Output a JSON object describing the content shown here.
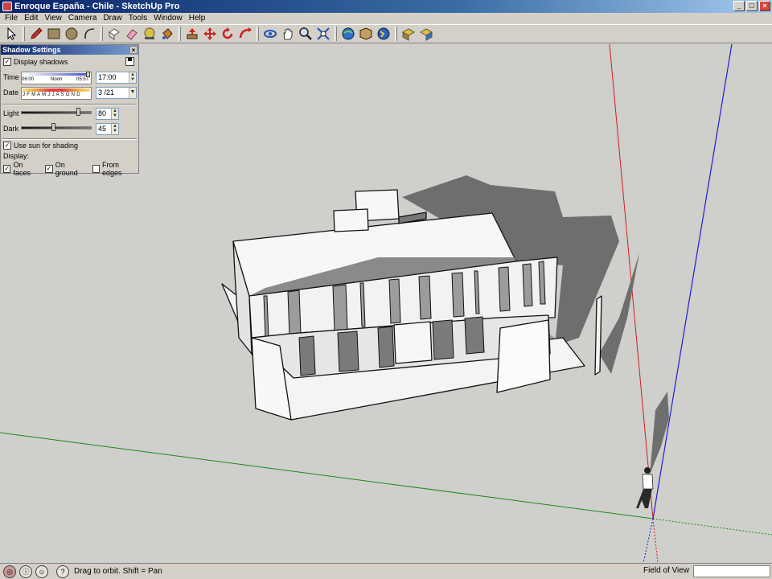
{
  "window": {
    "title": "Enroque España - Chile - SketchUp Pro",
    "controls": [
      "_",
      "□",
      "×"
    ]
  },
  "menu": [
    "File",
    "Edit",
    "View",
    "Camera",
    "Draw",
    "Tools",
    "Window",
    "Help"
  ],
  "toolbar_icons": [
    "select-icon",
    "pencil-icon",
    "rectangle-icon",
    "circle-icon",
    "arc-icon",
    "make-component-icon",
    "eraser-icon",
    "tape-measure-icon",
    "paint-bucket-icon",
    "push-pull-icon",
    "move-icon",
    "rotate-icon",
    "follow-me-icon",
    "orbit-icon",
    "pan-icon",
    "zoom-icon",
    "zoom-extents-icon",
    "get-models-icon",
    "share-model-icon",
    "google-earth-icon",
    "get-photo-texture-icon",
    "share-component-icon"
  ],
  "shadow_panel": {
    "title": "Shadow Settings",
    "display_shadows_label": "Display shadows",
    "display_shadows_checked": true,
    "time_label": "Time",
    "time_start": "06:00",
    "time_noon": "Noon",
    "time_end": "05:57",
    "time_value": "17:00",
    "date_label": "Date",
    "date_months": "J F M A M J J A S O N D",
    "date_value": "3 /21",
    "light_label": "Light",
    "light_value": "80",
    "dark_label": "Dark",
    "dark_value": "45",
    "use_sun_label": "Use sun for shading",
    "use_sun_checked": true,
    "display_label": "Display:",
    "on_faces_label": "On faces",
    "on_faces_checked": true,
    "on_ground_label": "On ground",
    "on_ground_checked": true,
    "from_edges_label": "From edges",
    "from_edges_checked": false
  },
  "status": {
    "hint": "Drag to orbit.  Shift = Pan",
    "measurement_label": "Field of View",
    "measurement_value": ""
  },
  "colors": {
    "red_axis": "#d02020",
    "green_axis": "#1a8a1a",
    "blue_axis": "#1e1ee0",
    "sky_ground": "#cfcfcb",
    "shadow": "#6e6e6e"
  }
}
